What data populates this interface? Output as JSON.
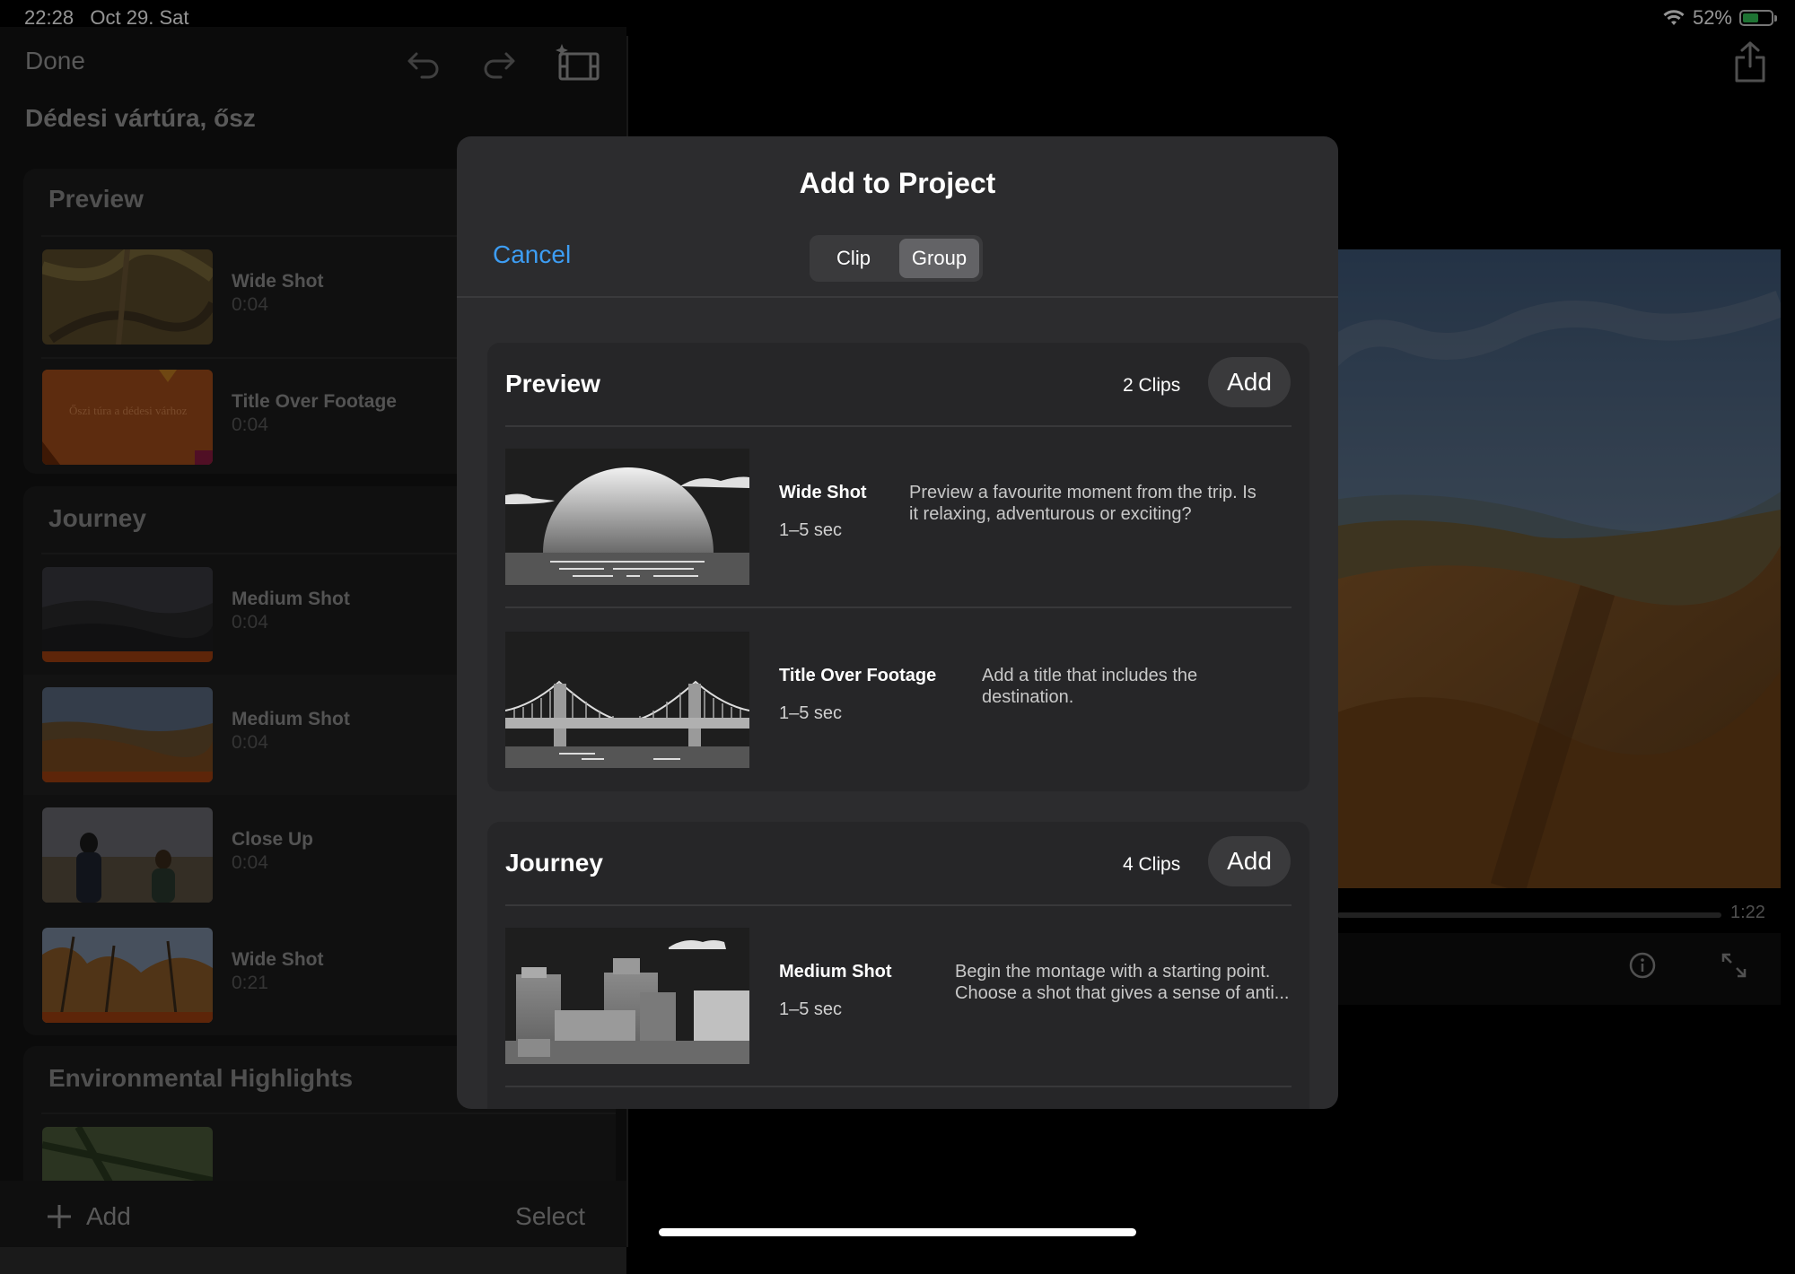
{
  "status": {
    "time": "22:28",
    "date": "Oct 29. Sat",
    "battery": "52%",
    "battery_level": 0.52
  },
  "left": {
    "done_label": "Done",
    "project_title": "Dédesi vártúra, ősz",
    "sections": [
      {
        "title": "Preview",
        "items": [
          {
            "title": "Wide Shot",
            "duration": "0:04"
          },
          {
            "title": "Title Over Footage",
            "duration": "0:04",
            "overlay_text": "Őszi túra a dédesi várhoz"
          }
        ]
      },
      {
        "title": "Journey",
        "items": [
          {
            "title": "Medium Shot",
            "duration": "0:04"
          },
          {
            "title": "Medium Shot",
            "duration": "0:04"
          },
          {
            "title": "Close Up",
            "duration": "0:04"
          },
          {
            "title": "Wide Shot",
            "duration": "0:21"
          }
        ]
      },
      {
        "title": "Environmental Highlights",
        "items": []
      }
    ],
    "add_label": "Add",
    "select_label": "Select"
  },
  "viewer": {
    "end_time": "1:22"
  },
  "modal": {
    "title": "Add to Project",
    "cancel_label": "Cancel",
    "segments": [
      {
        "label": "Clip",
        "active": false
      },
      {
        "label": "Group",
        "active": true
      }
    ],
    "groups": [
      {
        "title": "Preview",
        "count": "2 Clips",
        "add_label": "Add",
        "items": [
          {
            "title": "Wide Shot",
            "duration": "1–5 sec",
            "description_lines": [
              "Preview a favourite moment from the trip. Is",
              "it relaxing, adventurous or exciting?"
            ]
          },
          {
            "title": "Title Over Footage",
            "duration": "1–5 sec",
            "description_lines": [
              "Add a title that includes the",
              "destination."
            ]
          }
        ]
      },
      {
        "title": "Journey",
        "count": "4 Clips",
        "add_label": "Add",
        "items": [
          {
            "title": "Medium Shot",
            "duration": "1–5 sec",
            "description_lines": [
              "Begin the montage with a starting point.",
              "Choose a shot that gives a sense of anti..."
            ]
          }
        ]
      }
    ]
  }
}
